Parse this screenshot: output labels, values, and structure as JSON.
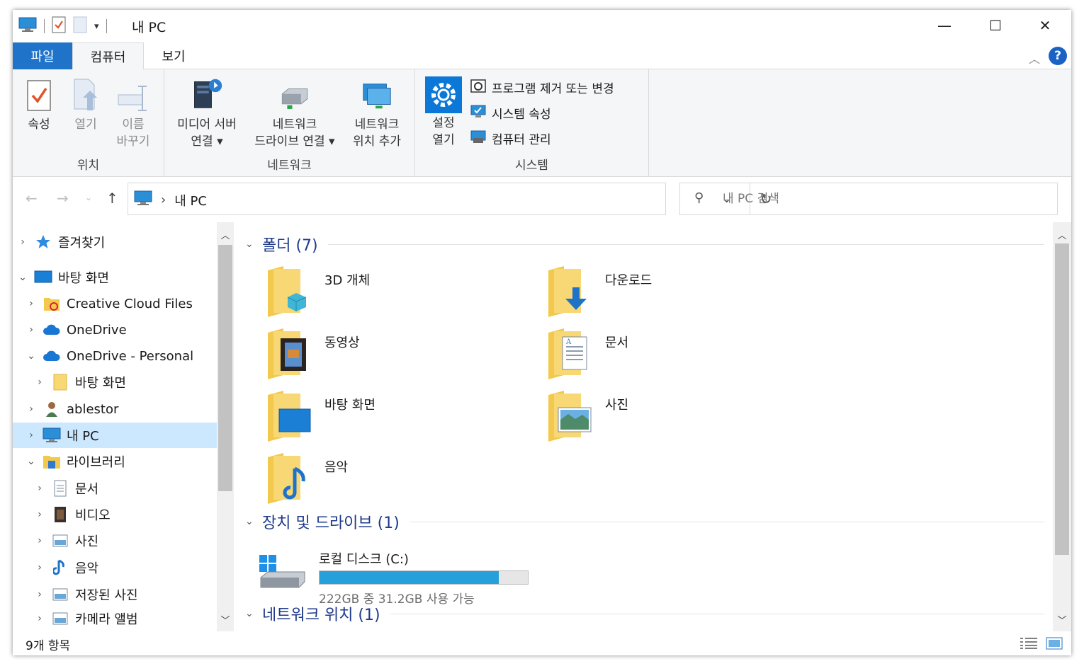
{
  "window": {
    "title": "내 PC",
    "controls": {
      "minimize": "—",
      "maximize": "☐",
      "close": "✕"
    }
  },
  "ribbon_tabs": [
    {
      "label": "파일"
    },
    {
      "label": "컴퓨터"
    },
    {
      "label": "보기"
    }
  ],
  "ribbon": {
    "location": {
      "label": "위치",
      "properties": "속성",
      "open": "열기",
      "rename_1": "이름",
      "rename_2": "바꾸기"
    },
    "network": {
      "label": "네트워크",
      "media_server_1": "미디어 서버",
      "media_server_2": "연결 ▾",
      "map_drive_1": "네트워크",
      "map_drive_2": "드라이브 연결 ▾",
      "add_location_1": "네트워크",
      "add_location_2": "위치 추가"
    },
    "system": {
      "label": "시스템",
      "open_settings_1": "설정",
      "open_settings_2": "열기",
      "uninstall": "프로그램 제거 또는 변경",
      "system_properties": "시스템 속성",
      "manage": "컴퓨터 관리"
    }
  },
  "address": {
    "breadcrumb_sep": "›",
    "path": "내 PC",
    "search_placeholder": "내 PC 검색"
  },
  "nav_tree": [
    {
      "label": "즐겨찾기",
      "chevron": "›",
      "icon": "star-icon"
    },
    {
      "label": "바탕 화면",
      "chevron": "⌄",
      "icon": "desktop-icon"
    },
    {
      "label": "Creative Cloud Files",
      "chevron": "›",
      "icon": "creative-cloud-folder-icon"
    },
    {
      "label": "OneDrive",
      "chevron": "›",
      "icon": "cloud-icon"
    },
    {
      "label": "OneDrive - Personal",
      "chevron": "⌄",
      "icon": "cloud-icon"
    },
    {
      "label": "바탕 화면",
      "chevron": "›",
      "icon": "folder-icon"
    },
    {
      "label": "ablestor",
      "chevron": "›",
      "icon": "user-icon"
    },
    {
      "label": "내 PC",
      "chevron": "›",
      "icon": "computer-icon"
    },
    {
      "label": "라이브러리",
      "chevron": "⌄",
      "icon": "library-icon"
    },
    {
      "label": "문서",
      "chevron": "›",
      "icon": "document-icon"
    },
    {
      "label": "비디오",
      "chevron": "›",
      "icon": "video-icon"
    },
    {
      "label": "사진",
      "chevron": "›",
      "icon": "picture-icon"
    },
    {
      "label": "음악",
      "chevron": "›",
      "icon": "music-icon"
    },
    {
      "label": "저장된 사진",
      "chevron": "›",
      "icon": "picture-icon"
    },
    {
      "label": "카메라 앨범",
      "chevron": "›",
      "icon": "picture-icon"
    }
  ],
  "sections": {
    "folders": "폴더 (7)",
    "drives": "장치 및 드라이브 (1)",
    "network": "네트워크 위치 (1)"
  },
  "folders": [
    {
      "name": "3D 개체",
      "icon": "3d-objects-folder-icon"
    },
    {
      "name": "다운로드",
      "icon": "downloads-folder-icon"
    },
    {
      "name": "동영상",
      "icon": "videos-folder-icon"
    },
    {
      "name": "문서",
      "icon": "documents-folder-icon"
    },
    {
      "name": "바탕 화면",
      "icon": "desktop-folder-icon"
    },
    {
      "name": "사진",
      "icon": "pictures-folder-icon"
    },
    {
      "name": "음악",
      "icon": "music-folder-icon"
    }
  ],
  "drive": {
    "name": "로컬 디스크 (C:)",
    "free_text": "222GB 중 31.2GB 사용 가능",
    "used_fraction": 0.86
  },
  "status": {
    "count": "9개 항목"
  },
  "colors": {
    "accent": "#1f73c8",
    "selected": "#cce8ff",
    "drive_bar": "#26a0da",
    "section_header": "#1e3a8a"
  }
}
